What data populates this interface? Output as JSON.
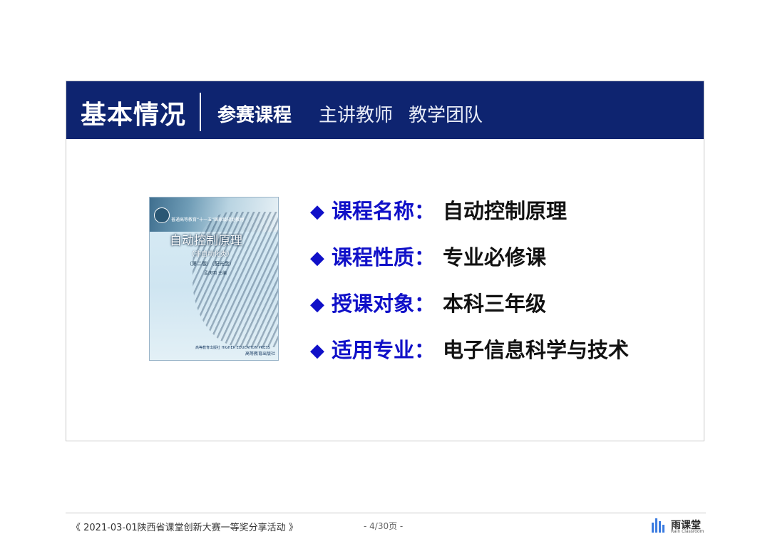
{
  "header": {
    "title": "基本情况",
    "tabs": [
      {
        "label": "参赛课程",
        "active": true
      },
      {
        "label": "主讲教师",
        "active": false
      },
      {
        "label": "教学团队",
        "active": false
      }
    ]
  },
  "book": {
    "series": "普通高等教育“十一五”国家级规划教材",
    "title": "自动控制原理",
    "subtitle": "（非自动化类）",
    "edition": "（第二版）（配光盘）",
    "author": "孟庆明  主编",
    "publisher": "高等教育出版社 HIGHER EDUCATION PRESS",
    "pub_mark": "高等教育出版社"
  },
  "items": [
    {
      "bullet": "◆",
      "label": "课程名称：",
      "value": "自动控制原理"
    },
    {
      "bullet": "◆",
      "label": "课程性质：",
      "value": "专业必修课"
    },
    {
      "bullet": "◆",
      "label": "授课对象：",
      "value": "本科三年级"
    },
    {
      "bullet": "◆",
      "label": "适用专业：",
      "value": "电子信息科学与技术"
    }
  ],
  "footer": {
    "event": "《 2021-03-01陕西省课堂创新大赛一等奖分享活动 》",
    "page": "- 4/30页 -",
    "brand_name": "雨课堂",
    "brand_sub": "Rain Classroom"
  },
  "colors": {
    "header_bg": "#0e2470",
    "accent_blue": "#1010c8",
    "text_dark": "#111111"
  }
}
